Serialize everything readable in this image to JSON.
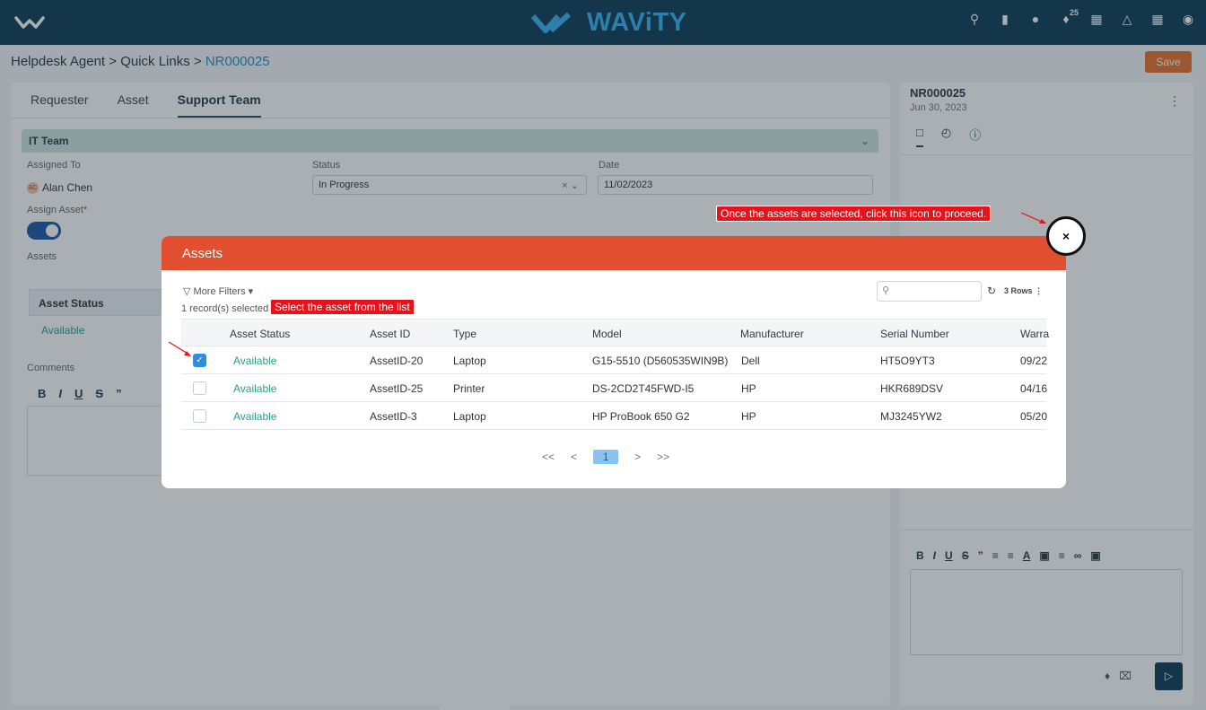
{
  "app": {
    "brand": "WAViTY",
    "notification_count": "25"
  },
  "breadcrumb": {
    "part1": "Helpdesk Agent",
    "sep1": ">",
    "part2": "Quick Links",
    "sep2": ">",
    "current": "NR000025"
  },
  "save_label": "Save",
  "tabs": [
    {
      "label": "Requester"
    },
    {
      "label": "Asset"
    },
    {
      "label": "Support Team"
    }
  ],
  "team": {
    "title": "IT Team",
    "assigned_to_label": "Assigned To",
    "assigned_to": "Alan Chen",
    "assigned_initials": "AC",
    "status_label": "Status",
    "status_value": "In Progress",
    "date_label": "Date",
    "date_value": "11/02/2023",
    "assign_asset_label": "Assign Asset",
    "assets_label": "Assets",
    "asset_status_header": "Asset Status",
    "asset_status_value": "Available",
    "comments_label": "Comments"
  },
  "ticket": {
    "id": "NR000025",
    "date": "Jun 30, 2023"
  },
  "modal": {
    "title": "Assets",
    "more_filters": "More Filters",
    "selected_text": "1 record(s) selected",
    "rows_label": "3 Rows",
    "columns": [
      "Asset Status",
      "Asset ID",
      "Type",
      "Model",
      "Manufacturer",
      "Serial Number",
      "Warra"
    ],
    "rows": [
      {
        "checked": true,
        "status": "Available",
        "asset_id": "AssetID-20",
        "type": "Laptop",
        "model": "G15-5510 (D560535WIN9B)",
        "manufacturer": "Dell",
        "serial": "HT5O9YT3",
        "warranty": "09/22"
      },
      {
        "checked": false,
        "status": "Available",
        "asset_id": "AssetID-25",
        "type": "Printer",
        "model": "DS-2CD2T45FWD-I5",
        "manufacturer": "HP",
        "serial": "HKR689DSV",
        "warranty": "04/16"
      },
      {
        "checked": false,
        "status": "Available",
        "asset_id": "AssetID-3",
        "type": "Laptop",
        "model": "HP ProBook 650 G2",
        "manufacturer": "HP",
        "serial": "MJ3245YW2",
        "warranty": "05/20"
      }
    ],
    "pager": {
      "first": "<<",
      "prev": "<",
      "current": "1",
      "next": ">",
      "last": ">>"
    }
  },
  "callouts": {
    "close_hint": "Once the assets are selected, click this icon to proceed.",
    "select_hint": "Select the asset from the list"
  },
  "colors": {
    "topbar": "#0f3c57",
    "modal_header": "#e24e30",
    "save": "#e8712d",
    "available": "#2aa186",
    "callout": "#e8131a"
  }
}
